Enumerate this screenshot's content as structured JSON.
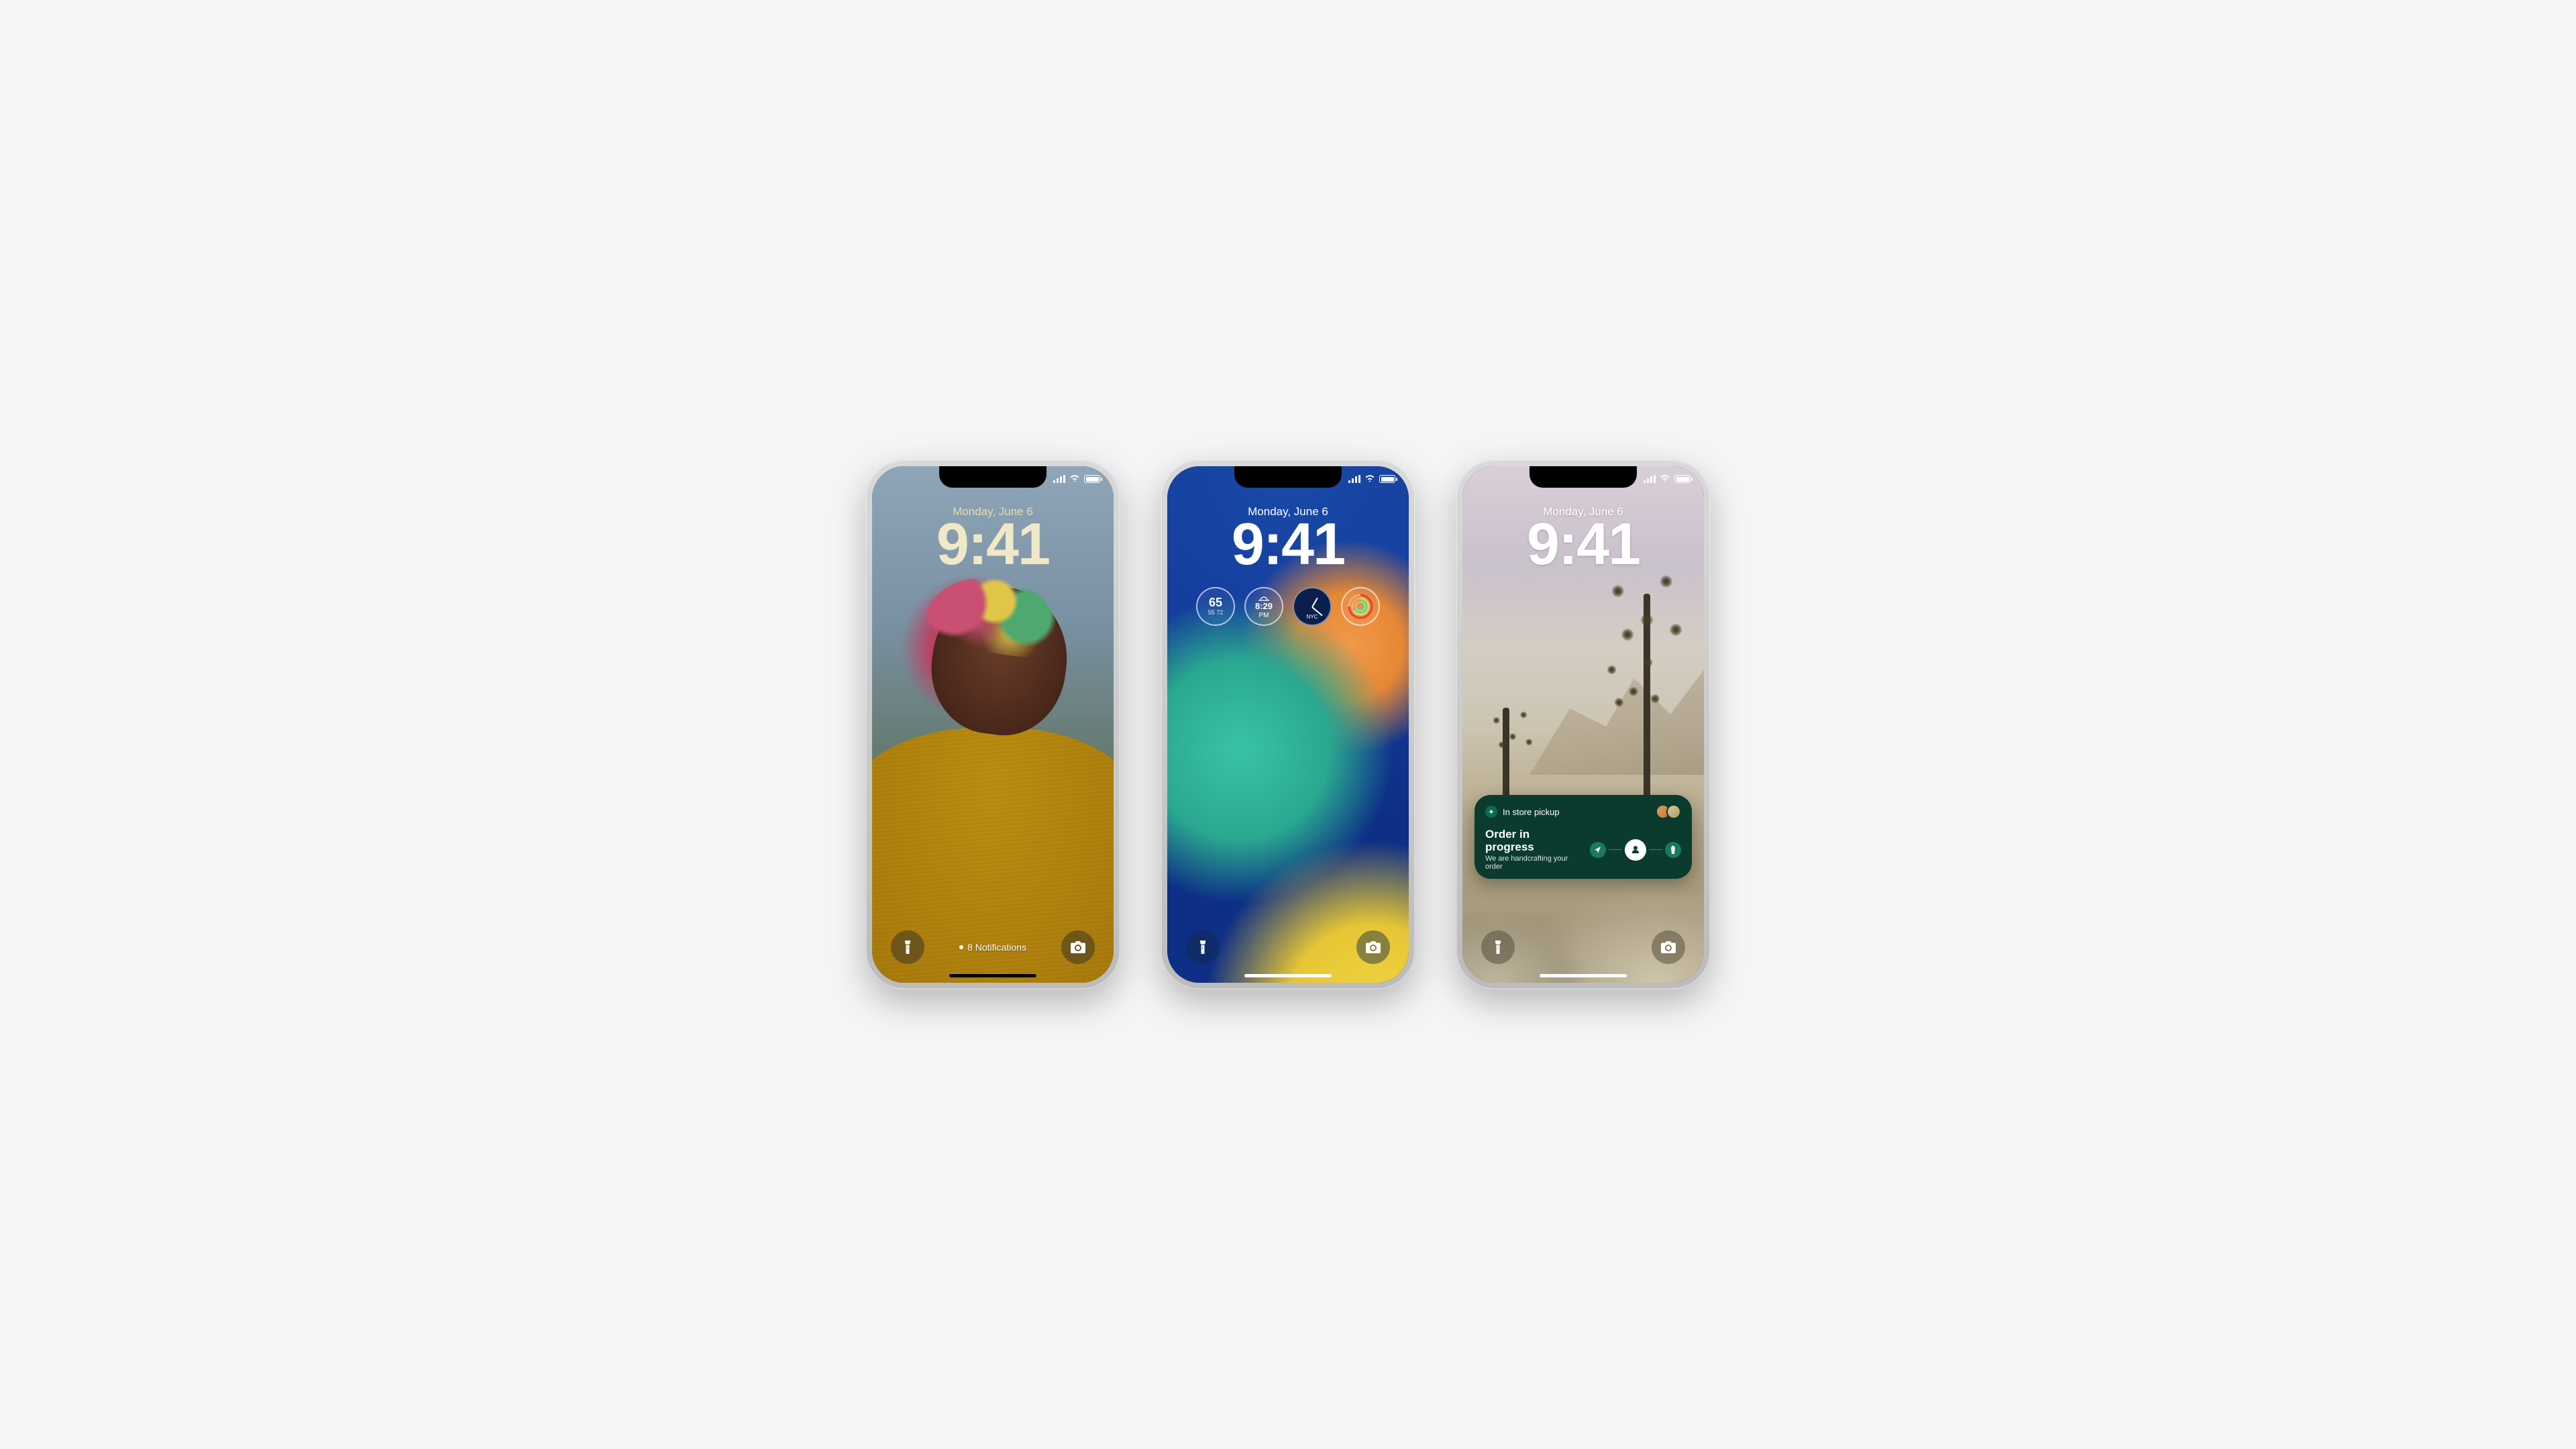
{
  "common": {
    "date": "Monday, June 6",
    "time": "9:41"
  },
  "phone1": {
    "notifications_label": "8 Notifications"
  },
  "phone2": {
    "widgets": {
      "temp_current": "65",
      "temp_low": "55",
      "temp_high": "72",
      "sunset_time": "8:29",
      "sunset_ampm": "PM",
      "clock_city": "NYC"
    }
  },
  "phone3": {
    "activity": {
      "brand_label": "In store pickup",
      "title": "Order in progress",
      "subtitle": "We are handcrafting your order"
    }
  }
}
